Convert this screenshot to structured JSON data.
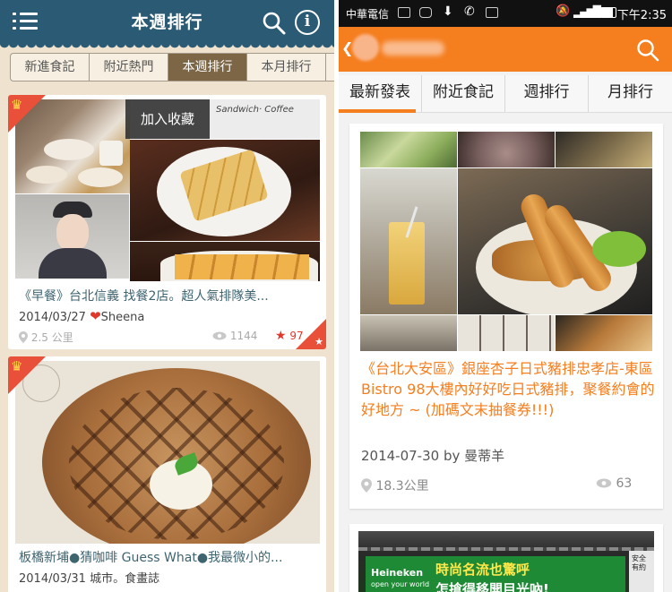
{
  "left": {
    "header": {
      "title": "本週排行"
    },
    "tabs": [
      {
        "label": "新進食記",
        "active": false
      },
      {
        "label": "附近熱門",
        "active": false
      },
      {
        "label": "本週排行",
        "active": true
      },
      {
        "label": "本月排行",
        "active": false
      }
    ],
    "cards": [
      {
        "title": "《早餐》台北信義 找餐2店。超人氣排隊美...",
        "date": "2014/03/27",
        "author": "Sheena",
        "distance": "2.5 公里",
        "views": "1144",
        "stars": "97",
        "favorite_label": "加入收藏",
        "photo_sign": "Sandwich· Coffee"
      },
      {
        "title": "板橋新埔●猜咖啡 Guess What●我最微小的...",
        "date": "2014/03/31",
        "author": "城市。食畫誌"
      }
    ]
  },
  "right": {
    "status_bar": {
      "carrier": "中華電信",
      "time": "下午2:35"
    },
    "tabs": [
      {
        "label": "最新發表",
        "active": true
      },
      {
        "label": "附近食記",
        "active": false
      },
      {
        "label": "週排行",
        "active": false
      },
      {
        "label": "月排行",
        "active": false
      }
    ],
    "cards": [
      {
        "title": "《台北大安區》銀座杏子日式豬排忠孝店-東區Bistro 98大樓內好好吃日式豬排，聚餐約會的好地方 ~ (加碼文末抽餐券!!!)",
        "date": "2014-07-30",
        "by": "by",
        "author": "曼蒂羊",
        "distance": "18.3公里",
        "views": "63"
      },
      {
        "banner_brand": "Heineken",
        "banner_tag": "open your world",
        "banner_line1": "時尚名流也驚呼",
        "banner_line2": "怎搶得移開目光吶!",
        "banner_side": "安全有約"
      }
    ]
  },
  "colors": {
    "left_header": "#2b5a74",
    "left_bg": "#efe3cf",
    "left_tab_active": "#7d6645",
    "right_accent": "#f57e1e",
    "right_bg": "#f2f2f2"
  }
}
